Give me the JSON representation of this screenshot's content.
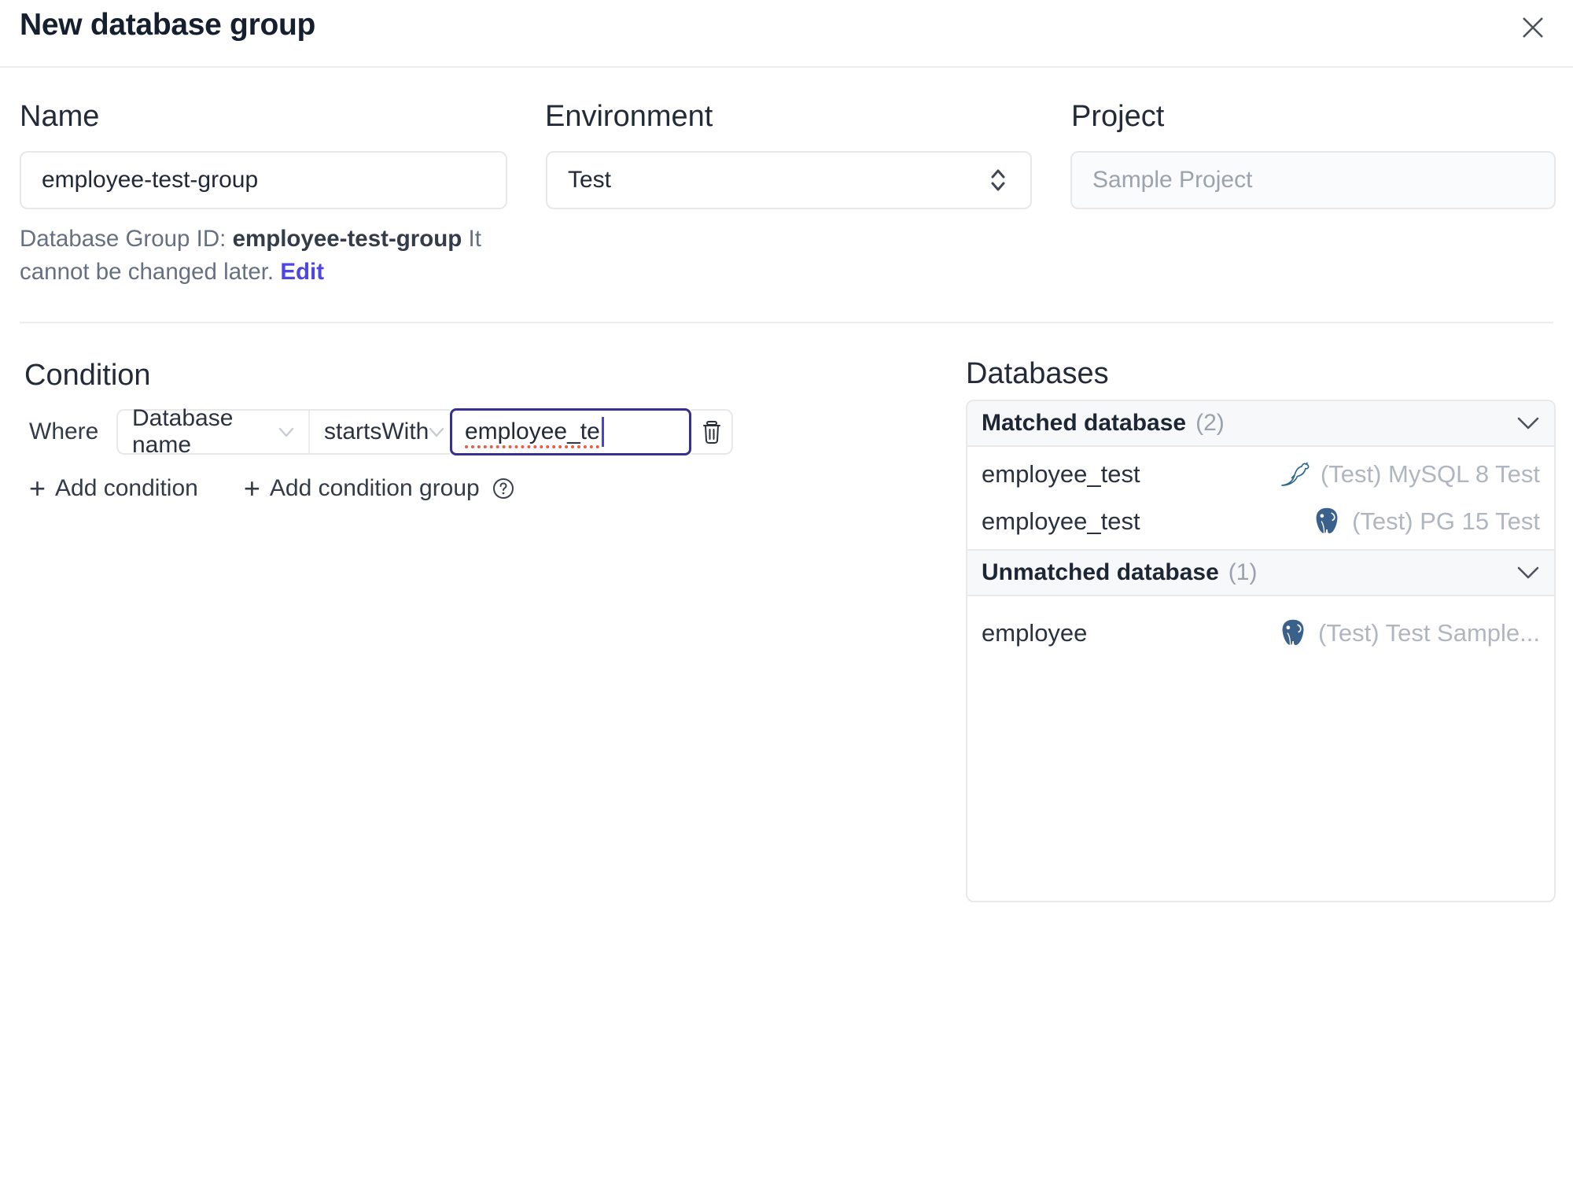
{
  "dialog": {
    "title": "New database group"
  },
  "form": {
    "name": {
      "label": "Name",
      "value": "employee-test-group"
    },
    "environment": {
      "label": "Environment",
      "value": "Test"
    },
    "project": {
      "label": "Project",
      "value": "Sample Project"
    },
    "id_note": {
      "prefix": "Database Group ID: ",
      "id": "employee-test-group",
      "suffix": " It cannot be changed later. ",
      "edit_label": "Edit"
    }
  },
  "condition": {
    "heading": "Condition",
    "where_label": "Where",
    "field": "Database name",
    "operator": "startsWith",
    "value": "employee_te",
    "add_condition_label": "Add condition",
    "add_condition_group_label": "Add condition group"
  },
  "databases": {
    "heading": "Databases",
    "groups": [
      {
        "title": "Matched database",
        "count": "(2)",
        "rows": [
          {
            "name": "employee_test",
            "engine": "mysql",
            "instance": "(Test) MySQL 8 Test"
          },
          {
            "name": "employee_test",
            "engine": "postgresql",
            "instance": "(Test) PG 15 Test"
          }
        ]
      },
      {
        "title": "Unmatched database",
        "count": "(1)",
        "rows": [
          {
            "name": "employee",
            "engine": "postgresql",
            "instance": "(Test) Test Sample..."
          }
        ]
      }
    ]
  },
  "colors": {
    "accent_indigo": "#4d46e0",
    "focus_border": "#37308f",
    "border": "#e7e9eb",
    "header_bg": "#f7f8f9",
    "muted_text": "#b0b6bf",
    "spellcheck_red": "#e2604f",
    "mysql_blue": "#2f6a8c",
    "postgres_blue": "#3a608c"
  }
}
